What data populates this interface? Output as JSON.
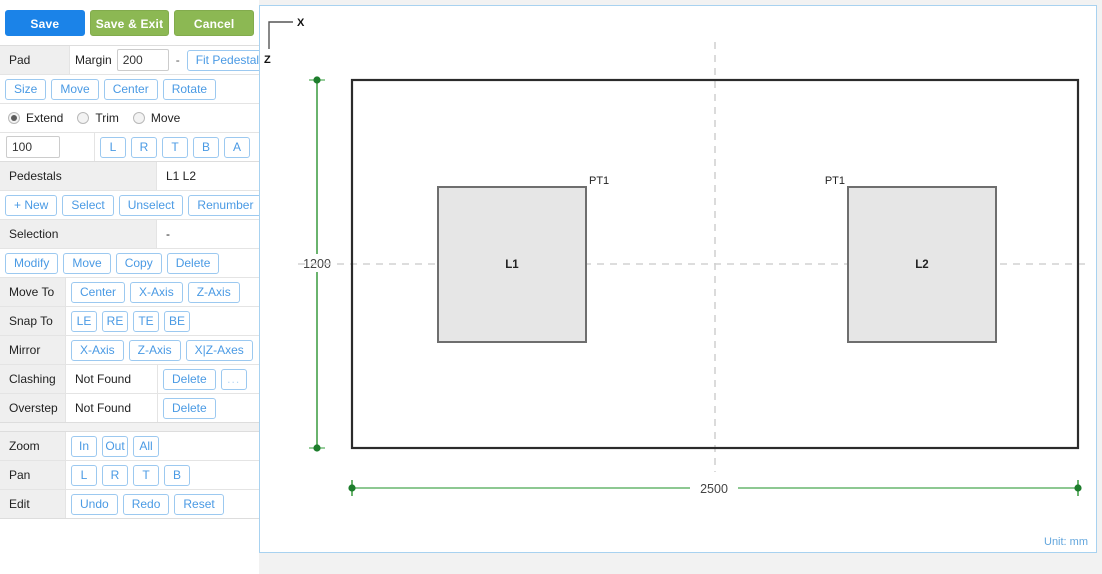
{
  "toolbar": {
    "save": "Save",
    "save_exit": "Save & Exit",
    "cancel": "Cancel",
    "save_color": "#1b83e8",
    "green_color": "#8cb853"
  },
  "sidebar": {
    "pad": {
      "label": "Pad",
      "margin_label": "Margin",
      "margin_value": "200",
      "separator": "-",
      "fit_pedestals": "Fit Pedestals"
    },
    "pad_ops": [
      "Size",
      "Move",
      "Center",
      "Rotate"
    ],
    "mode": {
      "options": [
        "Extend",
        "Trim",
        "Move"
      ],
      "selected": "Extend"
    },
    "nudge": {
      "value": "100",
      "buttons": [
        "L",
        "R",
        "T",
        "B",
        "A"
      ]
    },
    "pedestals": {
      "label": "Pedestals",
      "value": "L1 L2",
      "buttons": [
        "+ New",
        "Select",
        "Unselect",
        "Renumber"
      ]
    },
    "selection": {
      "label": "Selection",
      "value": "-",
      "buttons": [
        "Modify",
        "Move",
        "Copy",
        "Delete"
      ]
    },
    "move_to": {
      "label": "Move To",
      "buttons": [
        "Center",
        "X-Axis",
        "Z-Axis"
      ]
    },
    "snap_to": {
      "label": "Snap To",
      "buttons": [
        "LE",
        "RE",
        "TE",
        "BE"
      ]
    },
    "mirror": {
      "label": "Mirror",
      "buttons": [
        "X-Axis",
        "Z-Axis",
        "X|Z-Axes"
      ]
    },
    "clashing": {
      "label": "Clashing",
      "value": "Not Found",
      "delete": "Delete",
      "more": "..."
    },
    "overstep": {
      "label": "Overstep",
      "value": "Not Found",
      "delete": "Delete"
    },
    "zoom": {
      "label": "Zoom",
      "buttons": [
        "In",
        "Out",
        "All"
      ]
    },
    "pan": {
      "label": "Pan",
      "buttons": [
        "L",
        "R",
        "T",
        "B"
      ]
    },
    "edit": {
      "label": "Edit",
      "buttons": [
        "Undo",
        "Redo",
        "Reset"
      ]
    }
  },
  "canvas": {
    "axis": {
      "x": "X",
      "z": "Z"
    },
    "unit": "Unit: mm",
    "dim_height": "1200",
    "dim_width": "2500",
    "pad_outline_color": "#2b2b2b",
    "dimension_color": "#2a9a3d",
    "pedestal_fill": "#e6e6e6",
    "pedestal_stroke": "#6e6e6e",
    "centerline_color": "#cfcfcf",
    "pedestals": [
      {
        "name": "L1",
        "corner_label": "PT1"
      },
      {
        "name": "L2",
        "corner_label": "PT1"
      }
    ]
  }
}
